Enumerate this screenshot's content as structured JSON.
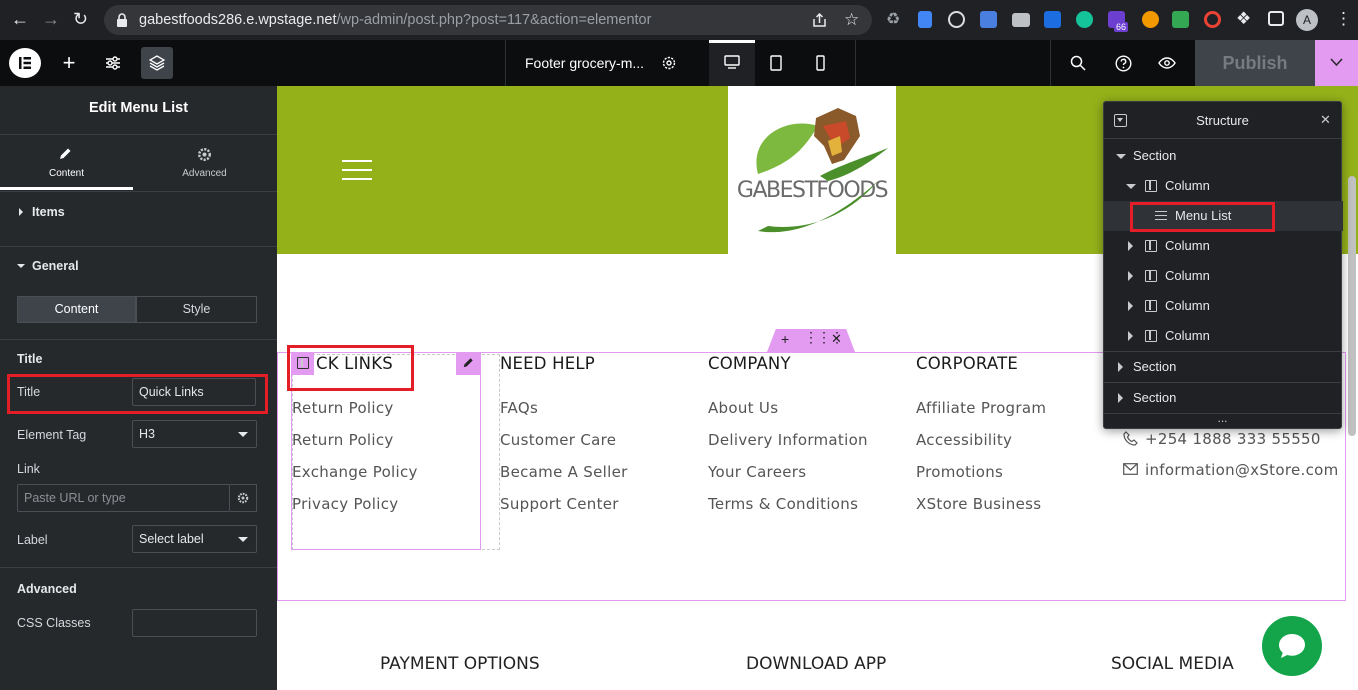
{
  "browser": {
    "url_host": "gabestfoods286.e.wpstage.net",
    "url_path": "/wp-admin/post.php?post=117&action=elementor",
    "ext_badge": "66",
    "profile_initial": "A"
  },
  "topbar": {
    "document_title": "Footer grocery-m...",
    "publish_label": "Publish"
  },
  "panel": {
    "heading": "Edit Menu List",
    "tabs": [
      {
        "label": "Content"
      },
      {
        "label": "Advanced"
      }
    ],
    "sections": {
      "items": "Items",
      "general": "General",
      "advanced": "Advanced"
    },
    "subtabs": {
      "content": "Content",
      "style": "Style"
    },
    "title_group": "Title",
    "fields": {
      "title_label": "Title",
      "title_value": "Quick Links",
      "element_tag_label": "Element Tag",
      "element_tag_value": "H3",
      "link_label": "Link",
      "link_placeholder": "Paste URL or type",
      "label_label": "Label",
      "label_value": "Select label",
      "css_classes_label": "CSS Classes"
    }
  },
  "canvas": {
    "logo_text": "GABESTFOODS",
    "columns": [
      {
        "heading": "CK LINKS",
        "links": [
          "Return Policy",
          "Return Policy",
          "Exchange Policy",
          "Privacy Policy"
        ]
      },
      {
        "heading": "NEED HELP",
        "links": [
          "FAQs",
          "Customer Care",
          "Became A Seller",
          "Support Center"
        ]
      },
      {
        "heading": "COMPANY",
        "links": [
          "About Us",
          "Delivery Information",
          "Your Careers",
          "Terms & Conditions"
        ]
      },
      {
        "heading": "CORPORATE",
        "links": [
          "Affiliate Program",
          "Accessibility",
          "Promotions",
          "XStore Business"
        ]
      }
    ],
    "contact": {
      "phone": "+254 1888 333 55550",
      "email": "information@xStore.com"
    },
    "bottom_headings": [
      "PAYMENT OPTIONS",
      "DOWNLOAD APP",
      "SOCIAL MEDIA"
    ]
  },
  "structure": {
    "title": "Structure",
    "rows": [
      "Section",
      "Column",
      "Menu List",
      "Column",
      "Column",
      "Column",
      "Column",
      "Section",
      "Section"
    ],
    "more": "..."
  },
  "colors": {
    "header_green": "#94b11a",
    "accent_pink": "#e29bf1",
    "highlight_red": "#e41e26",
    "chat_green": "#14a54b"
  }
}
